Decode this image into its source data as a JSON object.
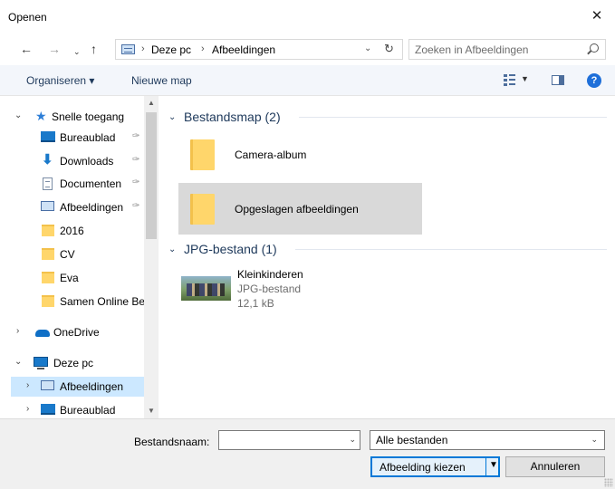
{
  "window": {
    "title": "Openen",
    "close_glyph": "✕"
  },
  "nav": {
    "back_glyph": "←",
    "forward_glyph": "→",
    "recent_glyph": "⌄",
    "up_glyph": "↑"
  },
  "address": {
    "icon": "pictures-folder-icon",
    "separator": "›",
    "crumbs": [
      "Deze pc",
      "Afbeeldingen"
    ],
    "dropdown_glyph": "⌄",
    "refresh_glyph": "↻"
  },
  "search": {
    "placeholder": "Zoeken in Afbeeldingen"
  },
  "toolbar": {
    "organize_label": "Organiseren ▾",
    "new_folder_label": "Nieuwe map",
    "view_drop_glyph": "▼",
    "help_glyph": "?"
  },
  "navpane": {
    "items": [
      {
        "label": "Snelle toegang",
        "icon": "star-icon",
        "expander": "⌄",
        "pinned": false
      },
      {
        "label": "Bureaublad",
        "icon": "desktop-icon",
        "pinned": true
      },
      {
        "label": "Downloads",
        "icon": "download-icon",
        "pinned": true
      },
      {
        "label": "Documenten",
        "icon": "documents-icon",
        "pinned": true
      },
      {
        "label": "Afbeeldingen",
        "icon": "pictures-icon",
        "pinned": true
      },
      {
        "label": "2016",
        "icon": "folder-icon"
      },
      {
        "label": "CV",
        "icon": "folder-icon"
      },
      {
        "label": "Eva",
        "icon": "folder-icon"
      },
      {
        "label": "Samen Online Be",
        "icon": "folder-icon"
      },
      {
        "label": "OneDrive",
        "icon": "cloud-icon",
        "expander": "›"
      },
      {
        "label": "Deze pc",
        "icon": "computer-icon",
        "expander": "⌄"
      },
      {
        "label": "Afbeeldingen",
        "icon": "pictures-icon",
        "expander": "›",
        "selected": true
      },
      {
        "label": "Bureaublad",
        "icon": "desktop-icon",
        "expander": "›"
      }
    ],
    "pin_glyph": "✑",
    "scroll_up_glyph": "▲",
    "scroll_down_glyph": "▼"
  },
  "content": {
    "groups": [
      {
        "header": "Bestandsmap (2)",
        "chevron": "⌄",
        "items": [
          {
            "name": "Camera-album",
            "icon": "folder-icon"
          },
          {
            "name": "Opgeslagen afbeeldingen",
            "icon": "folder-icon",
            "selected": true
          }
        ]
      },
      {
        "header": "JPG-bestand (1)",
        "chevron": "⌄",
        "items": [
          {
            "name": "Kleinkinderen",
            "type": "JPG-bestand",
            "size": "12,1 kB",
            "icon": "image-thumbnail"
          }
        ]
      }
    ]
  },
  "footer": {
    "filename_label": "Bestandsnaam:",
    "filename_value": "",
    "filename_drop_glyph": "⌄",
    "filetype_value": "Alle bestanden",
    "filetype_drop_glyph": "⌄",
    "open_button_label": "Afbeelding kiezen",
    "open_drop_glyph": "▼",
    "cancel_button_label": "Annuleren"
  },
  "colors": {
    "accent": "#0078d7",
    "selection": "#cce8ff",
    "folder": "#ffd66b",
    "toolbar_bg": "#f3f6fb",
    "footer_bg": "#f0f0f0"
  }
}
